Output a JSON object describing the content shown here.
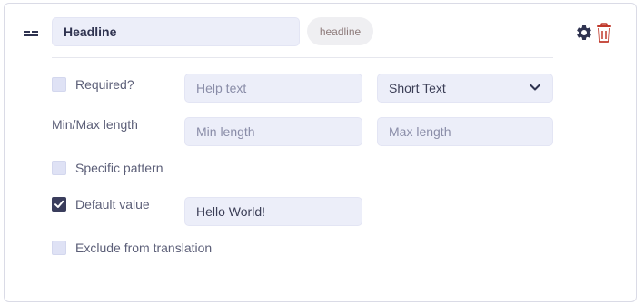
{
  "field": {
    "title_value": "Headline",
    "slug": "headline"
  },
  "options": {
    "required_label": "Required?",
    "required_checked": false,
    "help_text_placeholder": "Help text",
    "type_selected": "Short Text",
    "minmax_label": "Min/Max length",
    "min_placeholder": "Min length",
    "max_placeholder": "Max length",
    "pattern_label": "Specific pattern",
    "pattern_checked": false,
    "default_label": "Default value",
    "default_checked": true,
    "default_value": "Hello World!",
    "exclude_label": "Exclude from translation",
    "exclude_checked": false
  },
  "icons": {
    "drag": "drag-handle-icon",
    "settings": "gear-icon",
    "delete": "trash-icon",
    "dropdown": "chevron-down-icon",
    "check": "checkmark-icon"
  },
  "colors": {
    "input_bg": "#eceef9",
    "checkbox_bg": "#dfe2f5",
    "checkbox_checked": "#3a3d5c",
    "gear": "#2f3350",
    "trash": "#c0392b",
    "text": "#5c5f78"
  }
}
